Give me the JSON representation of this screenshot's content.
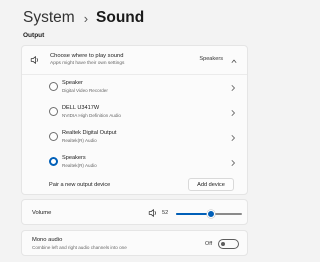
{
  "colors": {
    "accent": "#005fb8",
    "background": "#f3f3f3",
    "card": "#fbfbfb"
  },
  "breadcrumb": {
    "parent": "System",
    "separator": "›",
    "current": "Sound"
  },
  "output": {
    "section_label": "Output",
    "header": {
      "icon": "speaker-icon",
      "title": "Choose where to play sound",
      "subtitle": "Apps might have their own settings",
      "value": "Speakers"
    },
    "devices": [
      {
        "name": "Speaker",
        "subtitle": "Digital Video Recorder",
        "selected": false
      },
      {
        "name": "DELL U3417W",
        "subtitle": "NVIDIA High Definition Audio",
        "selected": false
      },
      {
        "name": "Realtek Digital Output",
        "subtitle": "Realtek(R) Audio",
        "selected": false
      },
      {
        "name": "Speakers",
        "subtitle": "Realtek(R) Audio",
        "selected": true
      }
    ],
    "pair": {
      "label": "Pair a new output device",
      "button": "Add device"
    }
  },
  "volume": {
    "label": "Volume",
    "icon": "speaker-icon",
    "value": "52",
    "level": 0.52
  },
  "mono": {
    "title": "Mono audio",
    "subtitle": "Combine left and right audio channels into one",
    "state_label": "Off",
    "on": false
  }
}
